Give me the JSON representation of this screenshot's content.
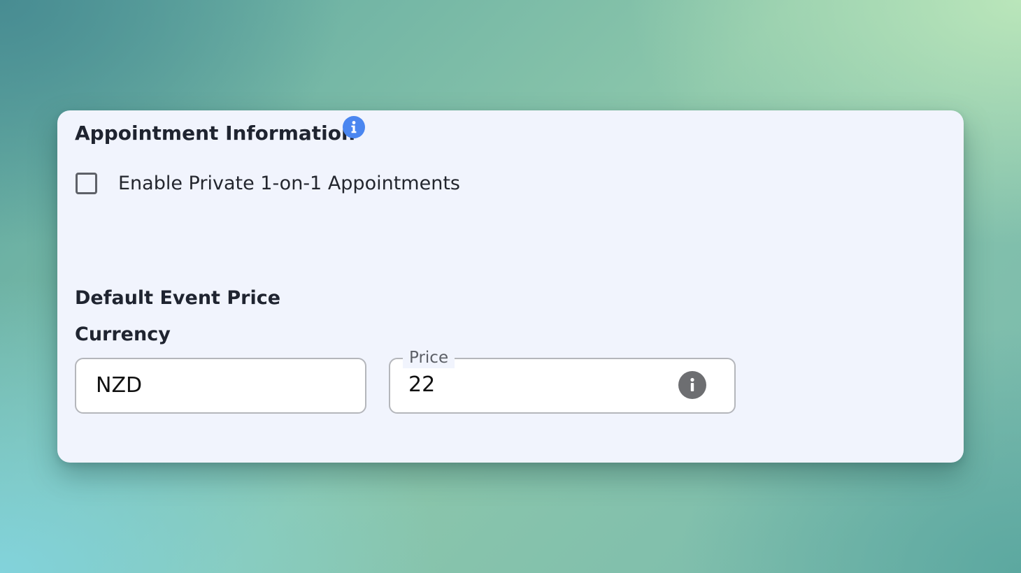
{
  "appointment": {
    "title": "Appointment Information",
    "info_icon": "info-circle-icon",
    "info_color": "#4a86f0",
    "checkbox_label": "Enable Private 1-on-1 Appointments",
    "checkbox_checked": false
  },
  "pricing": {
    "heading": "Default Event Price",
    "currency_label": "Currency",
    "currency_value": "NZD",
    "price_label": "Price",
    "price_value": "22",
    "price_info_icon": "info-circle-icon"
  }
}
